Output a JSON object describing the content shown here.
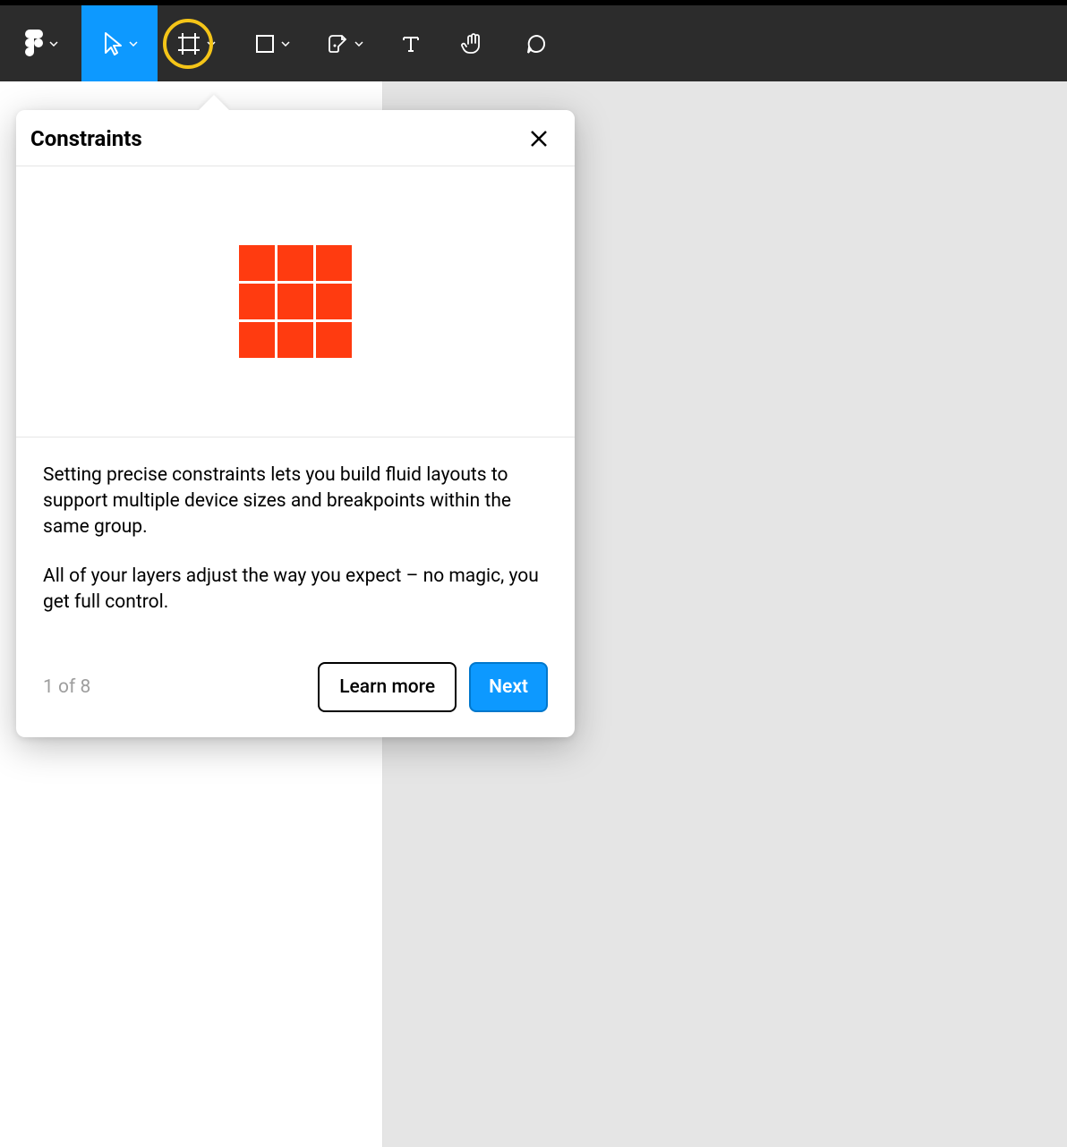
{
  "modal": {
    "title": "Constraints",
    "description1": "Setting precise constraints lets you build fluid layouts to support multiple device sizes and breakpoints within the same group.",
    "description2": "All of your layers adjust the way you expect – no magic, you get full control.",
    "step_indicator": "1 of 8",
    "learn_more_label": "Learn more",
    "next_label": "Next"
  },
  "toolbar": {
    "selected": "move"
  },
  "colors": {
    "accent": "#0d99ff",
    "highlight_ring": "#f5c518",
    "illustration_square": "#ff3b10",
    "toolbar_bg": "#2c2c2c"
  }
}
